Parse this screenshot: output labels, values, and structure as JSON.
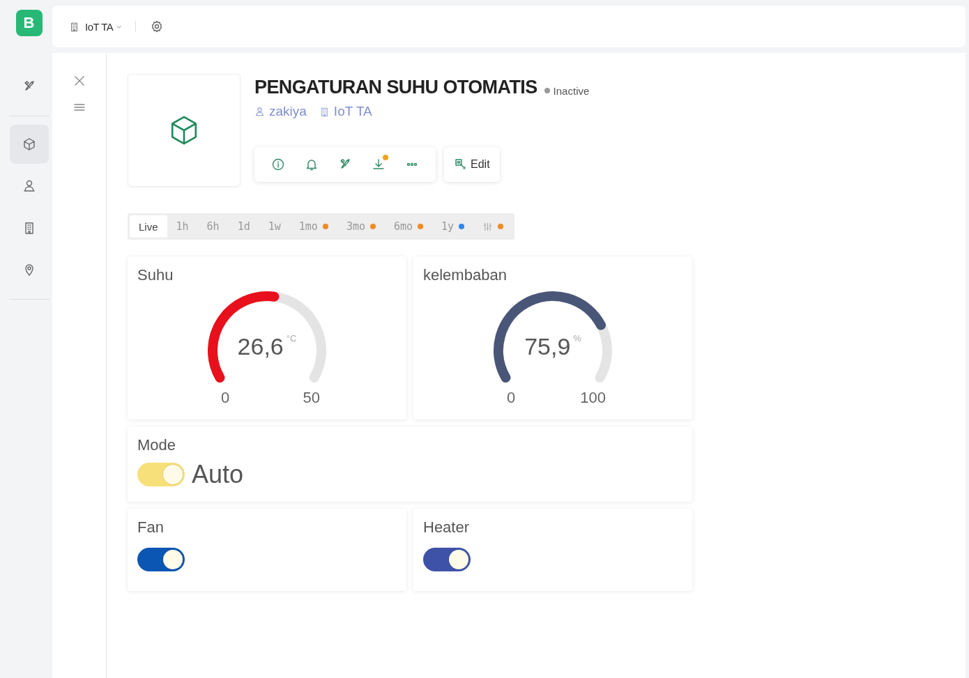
{
  "logo": "B",
  "top_bar": {
    "org": "IoT TA"
  },
  "rail": [
    {
      "selected": false
    },
    {
      "selected": true
    },
    {
      "selected": false
    },
    {
      "selected": false
    },
    {
      "selected": false
    }
  ],
  "device": {
    "title": "PENGATURAN SUHU OTOMATIS",
    "status": "Inactive",
    "owner": "zakiya",
    "org": "IoT TA",
    "actions": [
      {
        "badge": false
      },
      {
        "badge": false
      },
      {
        "badge": false
      },
      {
        "badge": true
      },
      {
        "badge": false
      }
    ],
    "edit": "Edit"
  },
  "time_ranges": [
    {
      "label": "Live",
      "selected": true
    },
    {
      "label": "1h",
      "selected": false
    },
    {
      "label": "6h",
      "selected": false
    },
    {
      "label": "1d",
      "selected": false
    },
    {
      "label": "1w",
      "selected": false
    },
    {
      "label": "1mo",
      "selected": false,
      "color": "#f08a24"
    },
    {
      "label": "3mo",
      "selected": false,
      "color": "#f08a24"
    },
    {
      "label": "6mo",
      "selected": false,
      "color": "#f08a24"
    },
    {
      "label": "1y",
      "selected": false,
      "color": "#2f86eb"
    },
    {
      "kind": "filter",
      "selected": false,
      "color": "#f08a24"
    }
  ],
  "widgets": [
    {
      "kind": "gauge",
      "title": "Suhu",
      "value": "26,6",
      "unit": "°C",
      "min": "0",
      "max": "50",
      "color": "#e8101c"
    },
    {
      "kind": "gauge",
      "title": "kelembaban",
      "value": "75,9",
      "unit": "%",
      "min": "0",
      "max": "100",
      "color": "#4a5677"
    },
    {
      "kind": "switch",
      "wide": true,
      "title": "Mode",
      "label": "Auto",
      "on": true,
      "color": "#f7e07a"
    },
    {
      "kind": "switch",
      "title": "Fan",
      "on": true,
      "color": "#0b56b3"
    },
    {
      "kind": "switch",
      "title": "Heater",
      "on": true,
      "color": "#3e52a8"
    }
  ]
}
